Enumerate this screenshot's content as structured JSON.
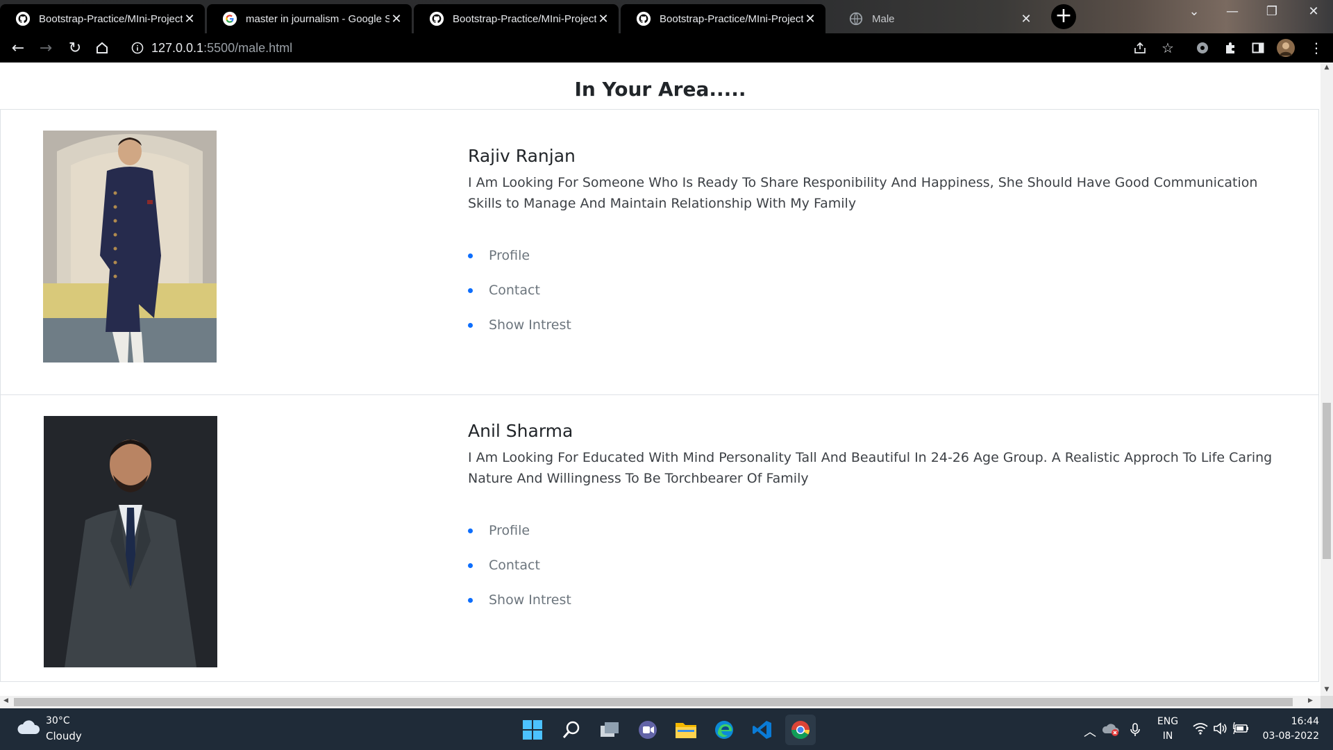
{
  "browser": {
    "tabs": [
      {
        "title": "Bootstrap-Practice/MIni-Project_",
        "icon": "github-icon",
        "active": true
      },
      {
        "title": "master in journalism - Google Se",
        "icon": "google-icon",
        "active": true
      },
      {
        "title": "Bootstrap-Practice/MIni-Project_",
        "icon": "github-icon",
        "active": true
      },
      {
        "title": "Bootstrap-Practice/MIni-Project_",
        "icon": "github-icon",
        "active": true
      },
      {
        "title": "Male",
        "icon": "globe-icon",
        "active": false
      }
    ],
    "close_glyph": "✕",
    "url_host": "127.0.0.1",
    "url_rest": ":5500/male.html"
  },
  "page": {
    "title": "In Your Area.....",
    "profiles": [
      {
        "name": "Rajiv Ranjan",
        "description": "I Am Looking For Someone Who Is Ready To Share Responibility And Happiness, She Should Have Good Communication Skills to Manage And Maintain Relationship With My Family",
        "links": [
          "Profile",
          "Contact",
          "Show Intrest"
        ]
      },
      {
        "name": "Anil Sharma",
        "description": "I Am Looking For Educated With Mind Personality Tall And Beautiful In 24-26 Age Group. A Realistic Approch To Life Caring Nature And Willingness To Be Torchbearer Of Family",
        "links": [
          "Profile",
          "Contact",
          "Show Intrest"
        ]
      }
    ],
    "accent_color": "#0d6efd"
  },
  "taskbar": {
    "weather_temp": "30°C",
    "weather_desc": "Cloudy",
    "language_top": "ENG",
    "language_bottom": "IN",
    "time": "16:44",
    "date": "03-08-2022",
    "apps": [
      "windows-start-icon",
      "search-icon",
      "task-view-icon",
      "teams-chat-icon",
      "file-explorer-icon",
      "edge-icon",
      "vscode-icon",
      "chrome-icon"
    ]
  }
}
